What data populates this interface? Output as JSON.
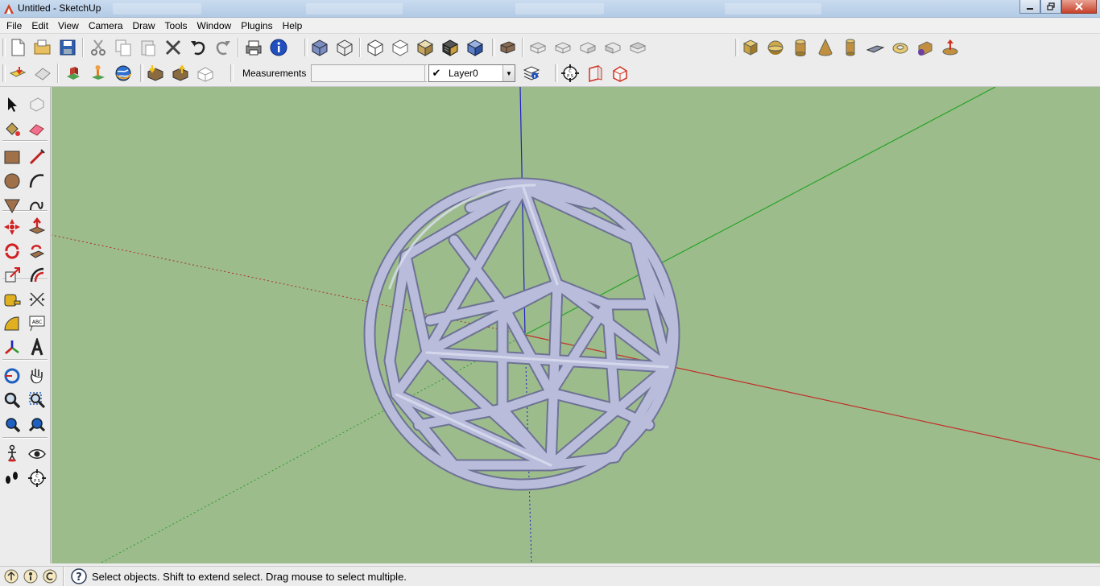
{
  "window": {
    "title": "Untitled - SketchUp",
    "controls": [
      "minimize",
      "maximize",
      "close"
    ]
  },
  "menu": [
    "File",
    "Edit",
    "View",
    "Camera",
    "Draw",
    "Tools",
    "Window",
    "Plugins",
    "Help"
  ],
  "toolbar": {
    "row1": {
      "standard": [
        "new-icon",
        "open-icon",
        "save-icon",
        "cut-icon",
        "copy-icon",
        "paste-icon",
        "erase-icon",
        "undo-icon",
        "redo-icon",
        "print-icon",
        "model-info-icon"
      ],
      "views": [
        "iso-view-icon",
        "wireframe-icon",
        "hidden-line-icon",
        "shaded-icon",
        "shaded-texture-icon",
        "monochrome-icon",
        "xray-icon"
      ],
      "sections": [
        "component-icon",
        "top-view-icon",
        "front-view-icon",
        "right-view-icon",
        "back-view-icon",
        "left-view-icon"
      ],
      "shapes": [
        "box-icon",
        "sphere-half-icon",
        "cylinder-icon",
        "cone-icon",
        "tube-icon",
        "plane-icon",
        "torus-icon",
        "helix-icon",
        "dome-icon"
      ]
    },
    "row2": {
      "google": [
        "get-location-icon",
        "toggle-terrain-icon",
        "place-model-icon",
        "get-models-icon",
        "share-model-icon",
        "preview-earth-icon"
      ],
      "warehouse": [
        "share-component-icon",
        "get-component-icon",
        "photo-texture-icon"
      ],
      "measurements_label": "Measurements",
      "measurements_value": "",
      "layer": {
        "selected": "Layer0",
        "checked": true
      },
      "layer_tools": [
        "layer-manager-icon"
      ],
      "section_tools": [
        "position-camera-icon",
        "section-plane-icon",
        "display-section-icon"
      ]
    }
  },
  "palette": {
    "tools": [
      "select-icon",
      "make-component-icon",
      "paint-bucket-icon",
      "eraser-icon",
      "rectangle-icon",
      "line-icon",
      "circle-icon",
      "arc-icon",
      "polygon-icon",
      "freehand-icon",
      "move-icon",
      "push-pull-icon",
      "rotate-icon",
      "follow-me-icon",
      "scale-icon",
      "offset-icon",
      "tape-measure-icon",
      "dimension-icon",
      "protractor-icon",
      "text-icon",
      "axes-icon",
      "3d-text-icon",
      "orbit-icon",
      "pan-icon",
      "zoom-icon",
      "zoom-window-icon",
      "previous-view-icon",
      "zoom-extents-icon",
      "walk-icon",
      "look-around-icon",
      "footprints-icon",
      "position-camera-icon"
    ]
  },
  "viewport": {
    "background": "#9dbc8c",
    "axis_colors": {
      "red": "#c0302a",
      "green": "#27a327",
      "blue": "#2020c8"
    },
    "model_color": "#b8bcd8"
  },
  "status": {
    "icons": [
      "geo-location-icon",
      "credits-icon",
      "sign-in-icon",
      "help-icon"
    ],
    "message": "Select objects. Shift to extend select. Drag mouse to select multiple."
  }
}
